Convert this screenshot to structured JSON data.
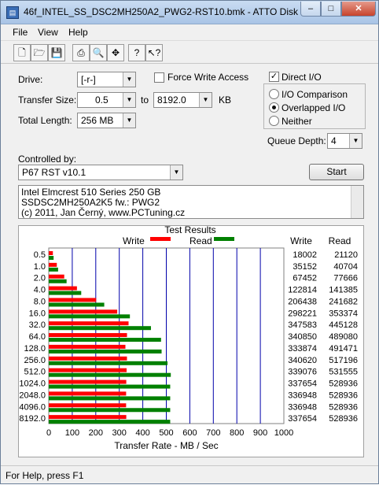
{
  "window": {
    "title": "46f_INTEL_SS_DSC2MH250A2_PWG2-RST10.bmk - ATTO Disk ..."
  },
  "menu": [
    "File",
    "View",
    "Help"
  ],
  "form": {
    "drive_label": "Drive:",
    "drive_value": "[-r-]",
    "force_write_label": "Force Write Access",
    "direct_io_label": "Direct I/O",
    "transfer_size_label": "Transfer Size:",
    "transfer_from": "0.5",
    "to_label": "to",
    "transfer_to": "8192.0",
    "kb_label": "KB",
    "io_comparison_label": "I/O Comparison",
    "overlapped_label": "Overlapped I/O",
    "neither_label": "Neither",
    "total_length_label": "Total Length:",
    "total_length_value": "256 MB",
    "queue_depth_label": "Queue Depth:",
    "queue_depth_value": "4",
    "controlled_by_label": "Controlled by:",
    "controlled_by_value": "P67 RST v10.1",
    "start_label": "Start",
    "description": [
      "Intel Elmcrest 510 Series 250 GB",
      "SSDSC2MH250A2K5 fw.: PWG2",
      "(c) 2011, Jan Černý, www.PCTuning.cz"
    ]
  },
  "results": {
    "title": "Test Results",
    "write_col": "Write",
    "read_col": "Read"
  },
  "status": {
    "text": "For Help, press F1"
  },
  "colors": {
    "write": "#ff0000",
    "read": "#008000",
    "grid": "#0000aa"
  },
  "chart_data": {
    "type": "bar",
    "title": "Test Results",
    "xlabel": "Transfer Rate - MB / Sec",
    "xlim": [
      0,
      1000
    ],
    "x_ticks": [
      "0",
      "100",
      "200",
      "300",
      "400",
      "500",
      "600",
      "700",
      "800",
      "900",
      "1000"
    ],
    "categories": [
      "0.5",
      "1.0",
      "2.0",
      "4.0",
      "8.0",
      "16.0",
      "32.0",
      "64.0",
      "128.0",
      "256.0",
      "512.0",
      "1024.0",
      "2048.0",
      "4096.0",
      "8192.0"
    ],
    "series": [
      {
        "name": "Write",
        "values": [
          18002,
          35152,
          67452,
          122814,
          206438,
          298221,
          347583,
          340850,
          333874,
          340620,
          339076,
          337654,
          336948,
          336948,
          337654
        ]
      },
      {
        "name": "Read",
        "values": [
          21120,
          40704,
          77666,
          141385,
          241682,
          353374,
          445128,
          489080,
          491471,
          517196,
          531555,
          528936,
          528936,
          528936,
          528936
        ]
      }
    ],
    "legend": "top"
  }
}
